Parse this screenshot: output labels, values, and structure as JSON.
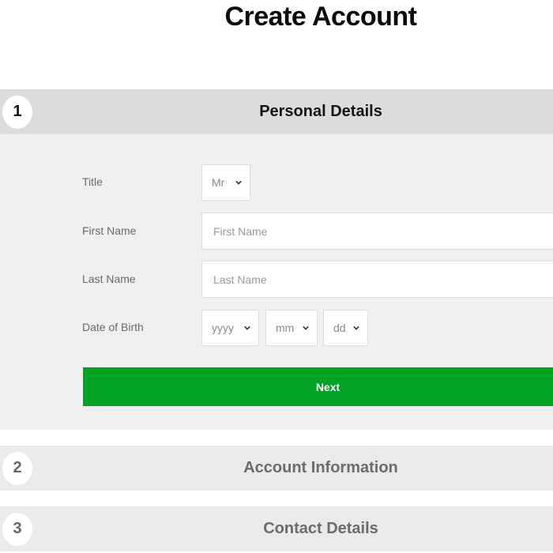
{
  "page": {
    "title": "Create Account"
  },
  "steps": [
    {
      "number": "1",
      "title": "Personal Details",
      "state": "active"
    },
    {
      "number": "2",
      "title": "Account Information",
      "state": "inactive"
    },
    {
      "number": "3",
      "title": "Contact Details",
      "state": "inactive"
    }
  ],
  "form": {
    "title": {
      "label": "Title",
      "selected": "Mr"
    },
    "first_name": {
      "label": "First Name",
      "value": "",
      "placeholder": "First Name"
    },
    "last_name": {
      "label": "Last Name",
      "value": "",
      "placeholder": "Last Name"
    },
    "date_of_birth": {
      "label": "Date of Birth",
      "year": "yyyy",
      "month": "mm",
      "day": "dd"
    },
    "next_label": "Next"
  },
  "colors": {
    "accent": "#02a324",
    "active_header_bg": "#dcdcdc",
    "inactive_header_bg": "#eaeaea",
    "panel_bg": "#efefef"
  }
}
